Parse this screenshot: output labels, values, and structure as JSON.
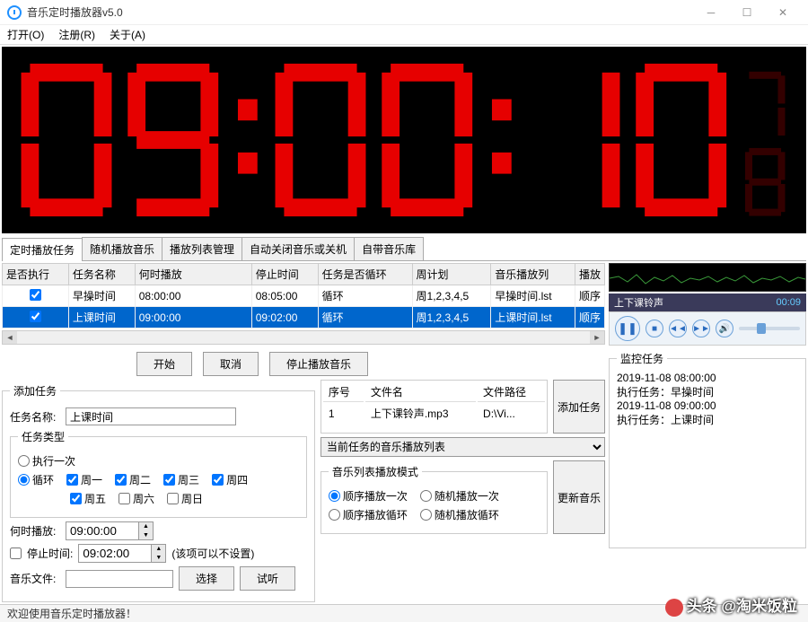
{
  "window": {
    "title": "音乐定时播放器v5.0"
  },
  "menu": {
    "open": "打开(O)",
    "register": "注册(R)",
    "about": "关于(A)"
  },
  "clock": "09:00:10",
  "tabs": [
    "定时播放任务",
    "随机播放音乐",
    "播放列表管理",
    "自动关闭音乐或关机",
    "自带音乐库"
  ],
  "grid": {
    "headers": [
      "是否执行",
      "任务名称",
      "何时播放",
      "停止时间",
      "任务是否循环",
      "周计划",
      "音乐播放列",
      "播放"
    ],
    "rows": [
      {
        "exec": true,
        "name": "早操时间",
        "when": "08:00:00",
        "stop": "08:05:00",
        "loop": "循环",
        "week": "周1,2,3,4,5",
        "list": "早操时间.lst",
        "mode": "顺序"
      },
      {
        "exec": true,
        "name": "上课时间",
        "when": "09:00:00",
        "stop": "09:02:00",
        "loop": "循环",
        "week": "周1,2,3,4,5",
        "list": "上课时间.lst",
        "mode": "顺序"
      }
    ]
  },
  "buttons": {
    "start": "开始",
    "cancel": "取消",
    "stopMusic": "停止播放音乐",
    "select": "选择",
    "preview": "试听",
    "addTask": "添加任务",
    "updateMusic": "更新音乐"
  },
  "add": {
    "legend": "添加任务",
    "nameLabel": "任务名称:",
    "nameValue": "上课时间",
    "typeLegend": "任务类型",
    "once": "执行一次",
    "loop": "循环",
    "weekdays": [
      "周一",
      "周二",
      "周三",
      "周四",
      "周五",
      "周六",
      "周日"
    ],
    "whenLabel": "何时播放:",
    "whenValue": "09:00:00",
    "stopLabel": "停止时间:",
    "stopValue": "09:02:00",
    "stopNote": "(该项可以不设置)",
    "fileLabel": "音乐文件:"
  },
  "filelist": {
    "headers": [
      "序号",
      "文件名",
      "文件路径"
    ],
    "row": {
      "idx": "1",
      "name": "上下课铃声.mp3",
      "path": "D:\\Vi..."
    }
  },
  "playlistSelect": "当前任务的音乐播放列表",
  "playmode": {
    "legend": "音乐列表播放模式",
    "seqOnce": "顺序播放一次",
    "randOnce": "随机播放一次",
    "seqLoop": "顺序播放循环",
    "randLoop": "随机播放循环"
  },
  "player": {
    "title": "上下课铃声",
    "time": "00:09"
  },
  "monitor": {
    "legend": "监控任务",
    "lines": [
      "2019-11-08 08:00:00",
      "执行任务：早操时间",
      "2019-11-08 09:00:00",
      "执行任务：上课时间"
    ]
  },
  "status": "欢迎使用音乐定时播放器！",
  "watermark": "头条 @淘米饭粒"
}
